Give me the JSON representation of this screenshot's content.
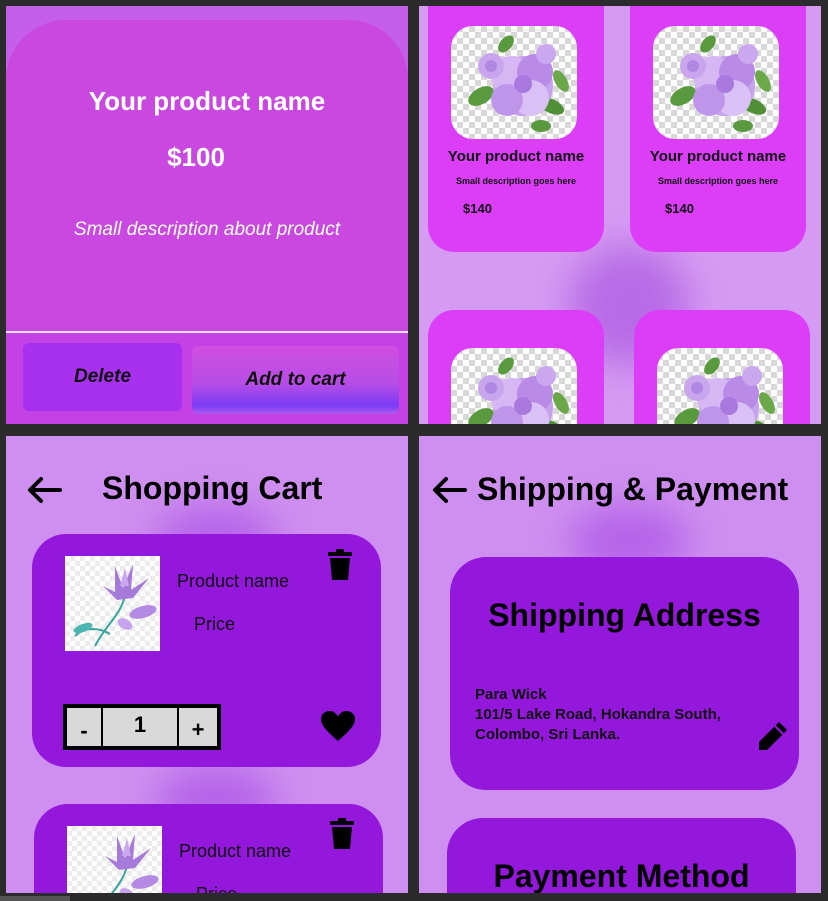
{
  "product_detail": {
    "name": "Your product name",
    "price": "$100",
    "description": "Small description about product",
    "delete_label": "Delete",
    "add_to_cart_label": "Add to cart"
  },
  "product_grid": {
    "items": [
      {
        "name": "Your product name",
        "description": "Small description goes here",
        "price": "$140"
      },
      {
        "name": "Your product name",
        "description": "Small description goes here",
        "price": "$140"
      }
    ]
  },
  "cart": {
    "title": "Shopping Cart",
    "items": [
      {
        "name": "Product name",
        "price": "Price",
        "quantity": "1"
      },
      {
        "name": "Product name",
        "price": "Price"
      }
    ],
    "minus_label": "-",
    "plus_label": "+"
  },
  "shipping": {
    "title": "Shipping & Payment",
    "address_title": "Shipping Address",
    "address_line1": "Para Wick",
    "address_line2": "101/5 Lake Road, Hokandra South,",
    "address_line3": "Colombo, Sri Lanka.",
    "payment_title": "Payment Method"
  },
  "colors": {
    "card_purple": "#9417dc",
    "magenta_card": "#dc3ef8",
    "background": "#cf8ff0"
  }
}
